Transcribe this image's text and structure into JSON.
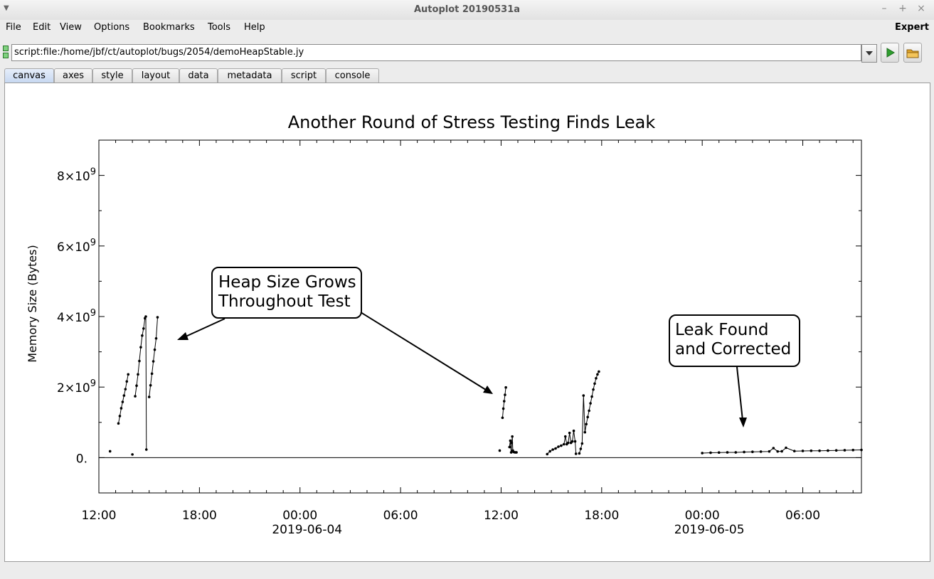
{
  "window": {
    "title": "Autoplot 20190531a"
  },
  "menu": {
    "items": [
      "File",
      "Edit",
      "View",
      "Options",
      "Bookmarks",
      "Tools",
      "Help"
    ],
    "right_label": "Expert"
  },
  "url": {
    "value": "script:file:/home/jbf/ct/autoplot/bugs/2054/demoHeapStable.jy"
  },
  "tabs": [
    "canvas",
    "axes",
    "style",
    "layout",
    "data",
    "metadata",
    "script",
    "console"
  ],
  "active_tab": "canvas",
  "colors": {
    "run_icon": "#2e9e2e",
    "folder_icon": "#e0a52a",
    "active_tab": "#c7d8f1"
  },
  "chart_data": {
    "type": "line",
    "title": "Another Round of Stress Testing Finds Leak",
    "ylabel": "Memory Size (Bytes)",
    "xlabel": "",
    "ylim": [
      -1000000000,
      9000000000
    ],
    "x_axis": {
      "start": "2019-06-03T12:00",
      "end": "2019-06-05T09:30",
      "ticks": [
        {
          "label": "12:00",
          "date": ""
        },
        {
          "label": "18:00",
          "date": ""
        },
        {
          "label": "00:00",
          "date": "2019-06-04"
        },
        {
          "label": "06:00",
          "date": ""
        },
        {
          "label": "12:00",
          "date": ""
        },
        {
          "label": "18:00",
          "date": ""
        },
        {
          "label": "00:00",
          "date": "2019-06-05"
        },
        {
          "label": "06:00",
          "date": ""
        }
      ]
    },
    "y_ticks": [
      {
        "mantissa": "0.",
        "exp": ""
      },
      {
        "mantissa": "2×10",
        "exp": "9"
      },
      {
        "mantissa": "4×10",
        "exp": "9"
      },
      {
        "mantissa": "6×10",
        "exp": "9"
      },
      {
        "mantissa": "8×10",
        "exp": "9"
      }
    ],
    "y_tick_values": [
      0,
      2000000000,
      4000000000,
      6000000000,
      8000000000
    ],
    "annotations": [
      {
        "line1": "Heap Size Grows",
        "line2": "Throughout Test"
      },
      {
        "line1": "Leak Found",
        "line2": "and Corrected"
      }
    ],
    "series": [
      {
        "x": [
          "2019-06-03T12:40"
        ],
        "y": [
          180000000
        ]
      },
      {
        "x": [
          "2019-06-03T13:10",
          "2019-06-03T13:15",
          "2019-06-03T13:20",
          "2019-06-03T13:25",
          "2019-06-03T13:30",
          "2019-06-03T13:35",
          "2019-06-03T13:40",
          "2019-06-03T13:45"
        ],
        "y": [
          970000000,
          1180000000,
          1400000000,
          1580000000,
          1760000000,
          1940000000,
          2160000000,
          2360000000
        ]
      },
      {
        "x": [
          "2019-06-03T14:00"
        ],
        "y": [
          90000000
        ]
      },
      {
        "x": [
          "2019-06-03T14:10",
          "2019-06-03T14:15",
          "2019-06-03T14:20",
          "2019-06-03T14:25",
          "2019-06-03T14:30",
          "2019-06-03T14:35",
          "2019-06-03T14:40",
          "2019-06-03T14:45",
          "2019-06-03T14:48",
          "2019-06-03T14:50"
        ],
        "y": [
          1740000000,
          2040000000,
          2360000000,
          2740000000,
          3130000000,
          3460000000,
          3660000000,
          3950000000,
          4000000000,
          230000000
        ]
      },
      {
        "x": [
          "2019-06-03T15:00",
          "2019-06-03T15:05",
          "2019-06-03T15:10",
          "2019-06-03T15:15",
          "2019-06-03T15:20",
          "2019-06-03T15:25",
          "2019-06-03T15:30"
        ],
        "y": [
          1720000000,
          2050000000,
          2380000000,
          2730000000,
          3060000000,
          3380000000,
          3980000000
        ]
      },
      {
        "x": [
          "2019-06-04T11:55"
        ],
        "y": [
          200000000
        ]
      },
      {
        "x": [
          "2019-06-04T12:05",
          "2019-06-04T12:08",
          "2019-06-04T12:11",
          "2019-06-04T12:14",
          "2019-06-04T12:17"
        ],
        "y": [
          1130000000,
          1390000000,
          1600000000,
          1780000000,
          1990000000
        ]
      },
      {
        "x": [
          "2019-06-04T12:30",
          "2019-06-04T12:33",
          "2019-06-04T12:36",
          "2019-06-04T12:38",
          "2019-06-04T12:40",
          "2019-06-04T12:42",
          "2019-06-04T12:45",
          "2019-06-04T12:50",
          "2019-06-04T12:55"
        ],
        "y": [
          300000000,
          480000000,
          150000000,
          420000000,
          600000000,
          200000000,
          160000000,
          150000000,
          150000000
        ]
      },
      {
        "x": [
          "2019-06-04T14:45",
          "2019-06-04T14:55",
          "2019-06-04T15:05",
          "2019-06-04T15:15",
          "2019-06-04T15:25",
          "2019-06-04T15:35",
          "2019-06-04T15:45",
          "2019-06-04T15:50",
          "2019-06-04T15:55",
          "2019-06-04T16:00",
          "2019-06-04T16:05",
          "2019-06-04T16:10",
          "2019-06-04T16:15",
          "2019-06-04T16:20",
          "2019-06-04T16:25",
          "2019-06-04T16:28"
        ],
        "y": [
          100000000,
          180000000,
          230000000,
          260000000,
          310000000,
          340000000,
          380000000,
          600000000,
          380000000,
          420000000,
          700000000,
          420000000,
          460000000,
          760000000,
          460000000,
          110000000
        ]
      },
      {
        "x": [
          "2019-06-04T16:40",
          "2019-06-04T16:45",
          "2019-06-04T16:50",
          "2019-06-04T16:55",
          "2019-06-04T17:00",
          "2019-06-04T17:05",
          "2019-06-04T17:10",
          "2019-06-04T17:15",
          "2019-06-04T17:20",
          "2019-06-04T17:25",
          "2019-06-04T17:30",
          "2019-06-04T17:35",
          "2019-06-04T17:40",
          "2019-06-04T17:45",
          "2019-06-04T17:50"
        ],
        "y": [
          120000000,
          250000000,
          400000000,
          1760000000,
          720000000,
          950000000,
          1150000000,
          1330000000,
          1540000000,
          1730000000,
          1930000000,
          2100000000,
          2250000000,
          2360000000,
          2440000000
        ]
      },
      {
        "x": [
          "2019-06-05T00:00",
          "2019-06-05T00:30",
          "2019-06-05T01:00",
          "2019-06-05T01:30",
          "2019-06-05T02:00",
          "2019-06-05T02:30",
          "2019-06-05T03:00",
          "2019-06-05T03:30",
          "2019-06-05T04:00",
          "2019-06-05T04:15",
          "2019-06-05T04:30",
          "2019-06-05T04:45",
          "2019-06-05T05:00",
          "2019-06-05T05:30",
          "2019-06-05T06:00",
          "2019-06-05T06:30",
          "2019-06-05T07:00",
          "2019-06-05T07:30",
          "2019-06-05T08:00",
          "2019-06-05T08:30",
          "2019-06-05T09:00",
          "2019-06-05T09:30"
        ],
        "y": [
          130000000,
          140000000,
          145000000,
          150000000,
          150000000,
          160000000,
          165000000,
          170000000,
          175000000,
          270000000,
          175000000,
          180000000,
          280000000,
          185000000,
          190000000,
          195000000,
          195000000,
          200000000,
          205000000,
          210000000,
          215000000,
          220000000
        ]
      }
    ]
  }
}
